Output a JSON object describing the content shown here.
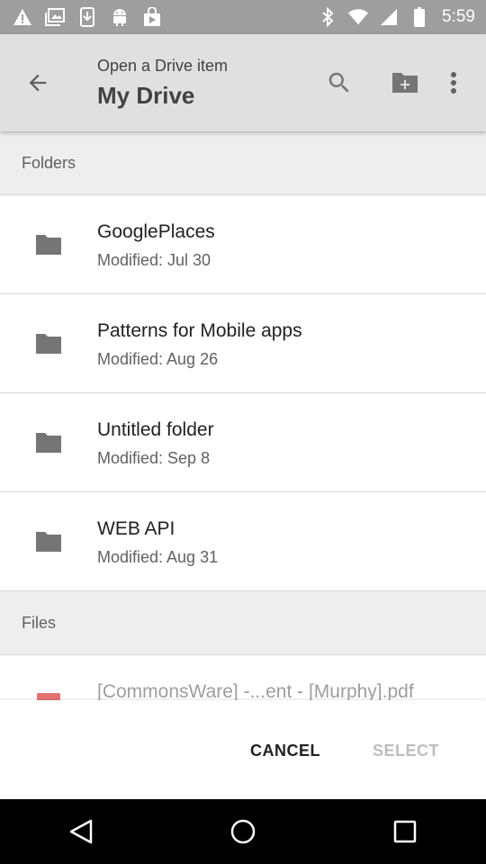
{
  "status_bar": {
    "time": "5:59",
    "left_icons": [
      "warning-icon",
      "image-icon",
      "download-icon",
      "android-icon",
      "play-store-icon"
    ],
    "right_icons": [
      "bluetooth-icon",
      "wifi-icon",
      "signal-icon",
      "battery-icon"
    ]
  },
  "app_bar": {
    "subtitle": "Open a Drive item",
    "title": "My Drive",
    "icons": [
      "back-arrow-icon",
      "search-icon",
      "new-folder-icon",
      "more-vert-icon"
    ]
  },
  "sections": {
    "folders_header": "Folders",
    "files_header": "Files"
  },
  "folders": [
    {
      "name": "GooglePlaces",
      "modified": "Modified: Jul 30"
    },
    {
      "name": "Patterns for Mobile apps",
      "modified": "Modified: Aug 26"
    },
    {
      "name": "Untitled folder",
      "modified": "Modified: Sep 8"
    },
    {
      "name": "WEB API",
      "modified": "Modified: Aug 31"
    }
  ],
  "files": [
    {
      "name": "[CommonsWare] -...ent - [Murphy].pdf",
      "icon": "pdf-icon"
    }
  ],
  "actions": {
    "cancel": "CANCEL",
    "select": "SELECT"
  },
  "colors": {
    "status_bar": "#9e9e9e",
    "app_bar": "#e0e0e0",
    "section_header": "#eeeeee",
    "folder_icon": "#757575",
    "pdf_icon": "#e57373",
    "disabled_text": "#bdbdbd"
  }
}
